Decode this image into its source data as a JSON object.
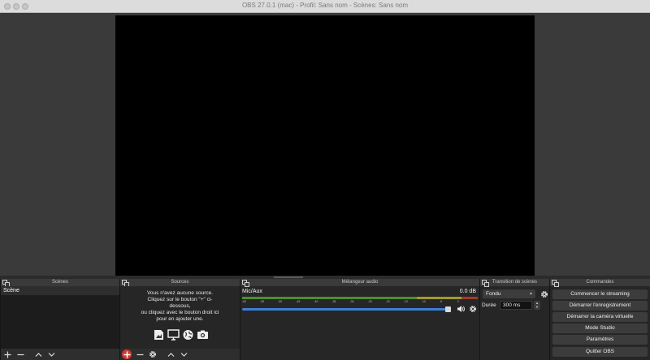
{
  "window": {
    "title": "OBS 27.0.1 (mac) - Profil: Sans nom - Scènes: Sans nom"
  },
  "docks": {
    "scenes": {
      "title": "Scènes",
      "items": [
        "Scène"
      ]
    },
    "sources": {
      "title": "Sources",
      "empty_message": "Vous n'avez aucune source.\nCliquez sur le bouton \"+\" ci-\ndessous,\nou cliquez avec le bouton droit ici\npour en ajouter une."
    },
    "mixer": {
      "title": "Mélangeur audio",
      "channel_name": "Mic/Aux",
      "level_db": "0.0 dB",
      "meter_ticks": [
        "-60",
        "-55",
        "-50",
        "-45",
        "-40",
        "-35",
        "-30",
        "-25",
        "-20",
        "-15",
        "-10",
        "-5",
        "0"
      ],
      "volume_fraction": 1.0
    },
    "transitions": {
      "title": "Transition de scènes",
      "selected": "Fondu",
      "duration_label": "Durée",
      "duration_value": "300 ms"
    },
    "controls": {
      "title": "Commandes",
      "buttons": [
        "Commencer le streaming",
        "Démarrer l'enregistrement",
        "Démarrer la caméra virtuelle",
        "Mode Studio",
        "Paramètres",
        "Quitter OBS"
      ]
    }
  },
  "colors": {
    "highlight_add": "#d2392e",
    "volume_bar": "#3d80d6"
  }
}
